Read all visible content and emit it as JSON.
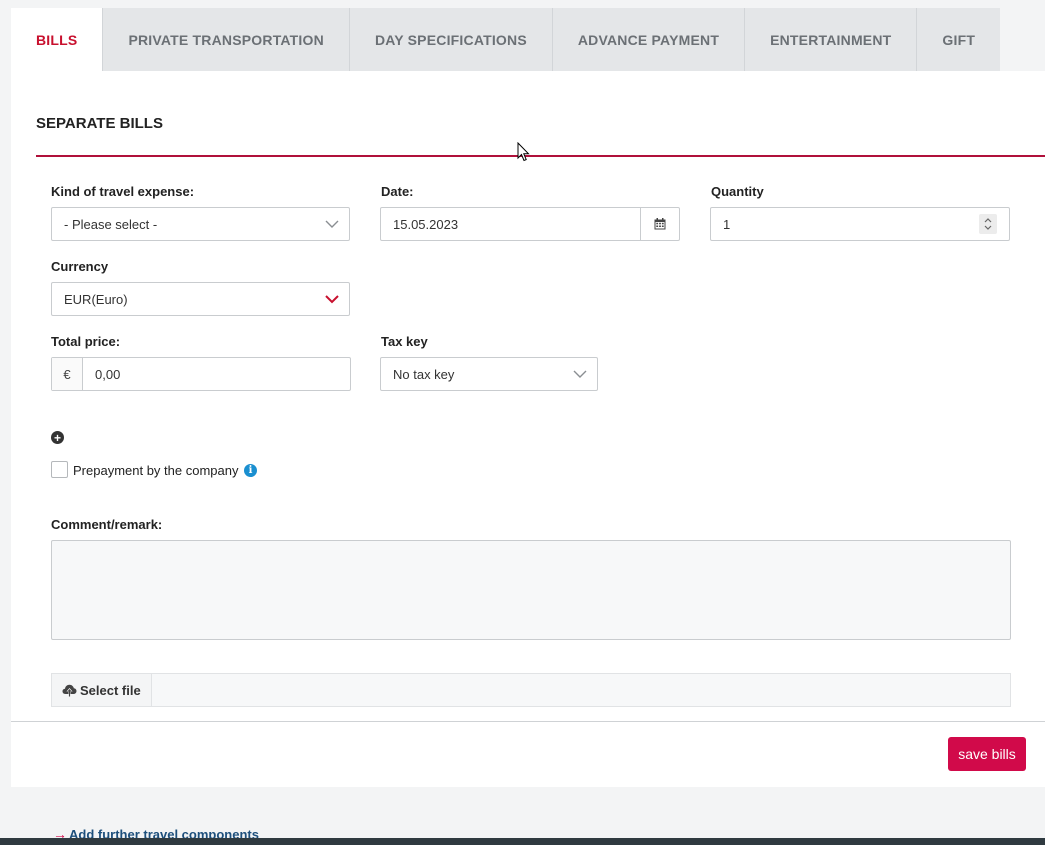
{
  "tabs": [
    {
      "label": "BILLS",
      "active": true
    },
    {
      "label": "PRIVATE TRANSPORTATION"
    },
    {
      "label": "DAY SPECIFICATIONS"
    },
    {
      "label": "ADVANCE PAYMENT"
    },
    {
      "label": "ENTERTAINMENT"
    },
    {
      "label": "GIFT"
    }
  ],
  "section": {
    "title": "SEPARATE BILLS"
  },
  "form": {
    "kind_label": "Kind of travel expense:",
    "kind_value": "- Please select -",
    "date_label": "Date:",
    "date_value": "15.05.2023",
    "quantity_label": "Quantity",
    "quantity_value": "1",
    "currency_label": "Currency",
    "currency_value": "EUR(Euro)",
    "total_label": "Total price:",
    "total_symbol": "€",
    "total_value": "0,00",
    "tax_label": "Tax key",
    "tax_value": "No tax key",
    "prepayment_label": "Prepayment by the company",
    "comment_label": "Comment/remark:",
    "select_file_label": "Select file"
  },
  "actions": {
    "save_label": "save bills",
    "add_further_label": "Add further travel components"
  },
  "colors": {
    "accent": "#c8102e",
    "save_button": "#d10a4a",
    "info": "#1a8fd0",
    "link": "#1d4f7c"
  },
  "icons": [
    "chevron-down-icon",
    "calendar-icon",
    "spinner-icon",
    "plus-circle-icon",
    "info-icon",
    "upload-icon",
    "arrow-right-icon"
  ]
}
